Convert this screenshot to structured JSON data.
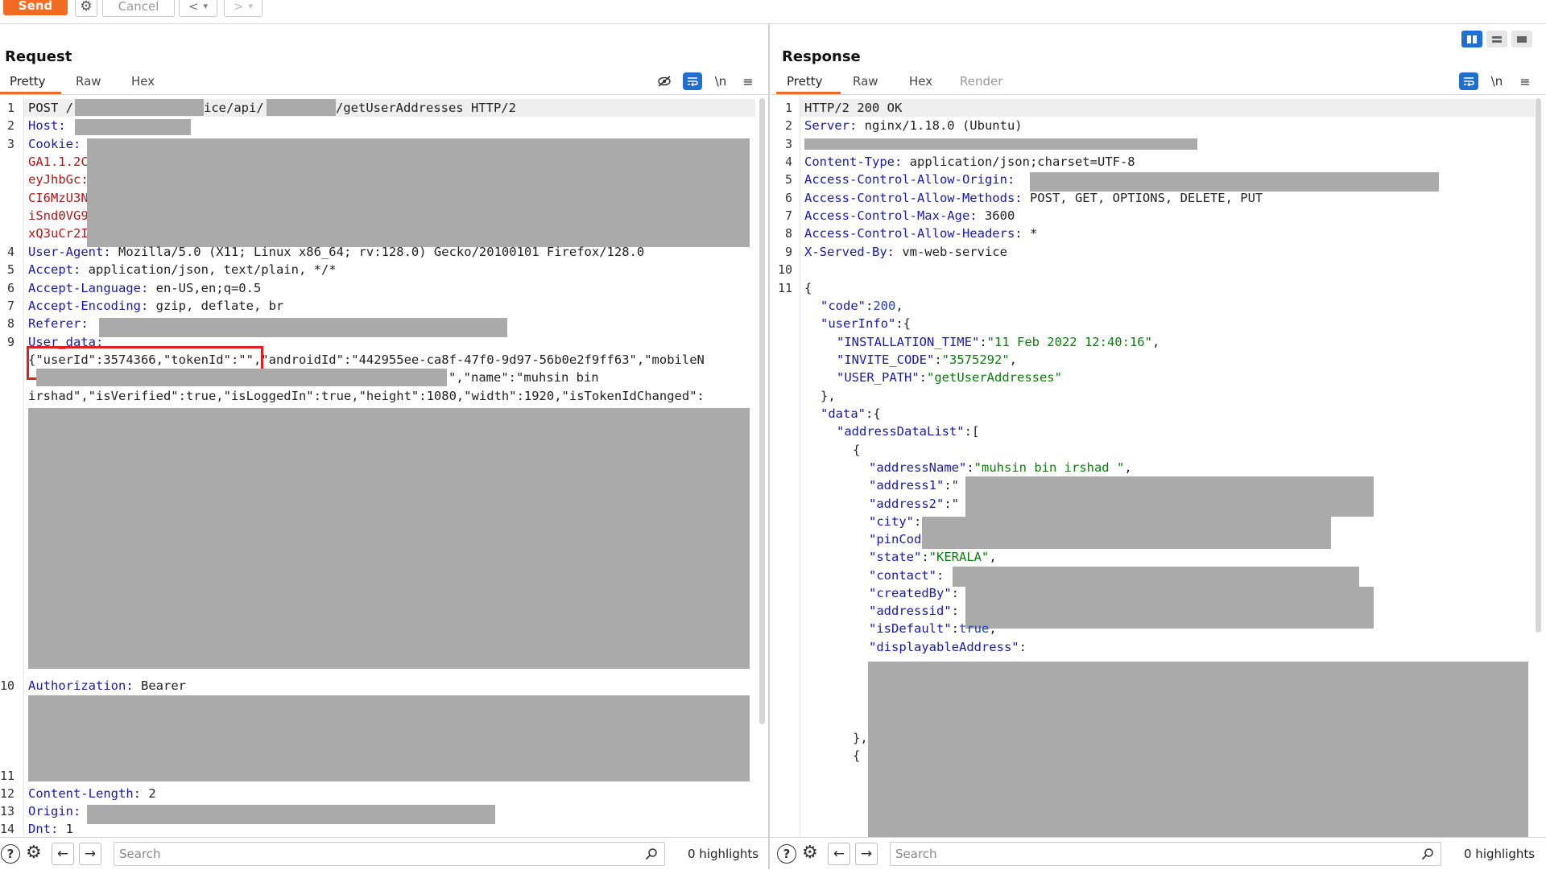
{
  "toolbar": {
    "send_label": "Send",
    "cancel_label": "Cancel",
    "back_label": "<",
    "forward_label": ">",
    "dropdown_glyph": "▾",
    "gear_glyph": "⚙"
  },
  "request": {
    "title": "Request",
    "tabs": [
      "Pretty",
      "Raw",
      "Hex"
    ],
    "active_tab": "Pretty",
    "icons": [
      "hide-icon",
      "wrap-icon",
      "newline-icon",
      "menu-icon"
    ],
    "newline_label": "\\n",
    "line_numbers": [
      "1",
      "2",
      "3",
      "4",
      "5",
      "6",
      "7",
      "8",
      "9",
      "10",
      "11",
      "12",
      "13",
      "14"
    ],
    "lines": {
      "l1a": "POST /",
      "l1b": "ice/api/",
      "l1c": "/getUserAddresses HTTP/2",
      "host_key": "Host:",
      "cookie_key": "Cookie:",
      "cookie_frag1": "GA1.1.2C",
      "cookie_frag2": "eyJhbGc:",
      "cookie_frag3": "CI6MzU3N",
      "cookie_frag4": "iSnd0VG9",
      "cookie_frag5": "xQ3uCr2I",
      "ua_key": "User-Agent:",
      "ua_val": " Mozilla/5.0 (X11; Linux x86_64; rv:128.0) Gecko/20100101 Firefox/128.0",
      "accept_key": "Accept:",
      "accept_val": " application/json, text/plain, */*",
      "lang_key": "Accept-Language:",
      "lang_val": " en-US,en;q=0.5",
      "enc_key": "Accept-Encoding:",
      "enc_val": " gzip, deflate, br",
      "referer_key": "Referer:",
      "userdata_key": "User_data:",
      "ud1a": "{\"userId\":3574366,\"tokenId\":\"",
      "ud1b": "\",\"androidId\":\"442955ee-ca8f-47f0-9d97-56b0e2f9ff63\",\"mobileN",
      "ud2": "\",\"name\":\"muhsin bin",
      "ud3": "irshad\",\"isVerified\":true,\"isLoggedIn\":true,\"height\":1080,\"width\":1920,\"isTokenIdChanged\":",
      "auth_key": "Authorization:",
      "auth_val": " Bearer",
      "cl_key": "Content-Length:",
      "cl_val": " 2",
      "origin_key": "Origin:",
      "dnt_key": "Dnt:",
      "dnt_val": " 1"
    },
    "search_placeholder": "Search",
    "highlights": "0 highlights"
  },
  "response": {
    "title": "Response",
    "tabs": [
      "Pretty",
      "Raw",
      "Hex",
      "Render"
    ],
    "active_tab": "Pretty",
    "newline_label": "\\n",
    "line_numbers": [
      "1",
      "2",
      "3",
      "4",
      "5",
      "6",
      "7",
      "8",
      "9",
      "10",
      "11"
    ],
    "lines": {
      "status": "HTTP/2 200 OK",
      "server_key": "Server:",
      "server_val": " nginx/1.18.0 (Ubuntu)",
      "ct_key": "Content-Type:",
      "ct_val": " application/json;charset=UTF-8",
      "acao_key": "Access-Control-Allow-Origin:",
      "acam_key": "Access-Control-Allow-Methods:",
      "acam_val": " POST, GET, OPTIONS, DELETE, PUT",
      "acma_key": "Access-Control-Max-Age:",
      "acma_val": " 3600",
      "acah_key": "Access-Control-Allow-Headers:",
      "acah_val": " *",
      "xsb_key": "X-Served-By:",
      "xsb_val": " vm-web-service",
      "j_open": "{",
      "j_code_key": "\"code\"",
      "j_code_val": "200",
      "j_userinfo_key": "\"userInfo\"",
      "j_inst_key": "\"INSTALLATION_TIME\"",
      "j_inst_val": "\"11 Feb 2022 12:40:16\"",
      "j_invite_key": "\"INVITE_CODE\"",
      "j_invite_val": "\"3575292\"",
      "j_path_key": "\"USER_PATH\"",
      "j_path_val": "\"getUserAddresses\"",
      "j_close_obj": "},",
      "j_data_key": "\"data\"",
      "j_adl_key": "\"addressDataList\"",
      "j_brace": "{",
      "j_addrname_key": "\"addressName\"",
      "j_addrname_val": "\"muhsin bin irshad \"",
      "j_addr1_key": "\"address1\"",
      "j_addr2_key": "\"address2\"",
      "j_city_key": "\"city\"",
      "j_pin_key": "\"pinCod",
      "j_state_key": "\"state\"",
      "j_state_val": "\"KERALA\"",
      "j_contact_key": "\"contact\"",
      "j_createdby_key": "\"createdBy\"",
      "j_addrid_key": "\"addressid\"",
      "j_default_key": "\"isDefault\"",
      "j_default_val": "true",
      "j_disp_key": "\"displayableAddress\"",
      "j_close_item": "},",
      "j_open_item": "{"
    },
    "search_placeholder": "Search",
    "highlights": "0 highlights"
  },
  "colors": {
    "accent": "#f26b22",
    "key": "#1a1aa6",
    "cookie_red": "#b01818",
    "string_green": "#0a7d0a",
    "redaction": "#aaaaaa",
    "highlight_box": "#e02020",
    "toggle_blue": "#1f6fd1"
  }
}
